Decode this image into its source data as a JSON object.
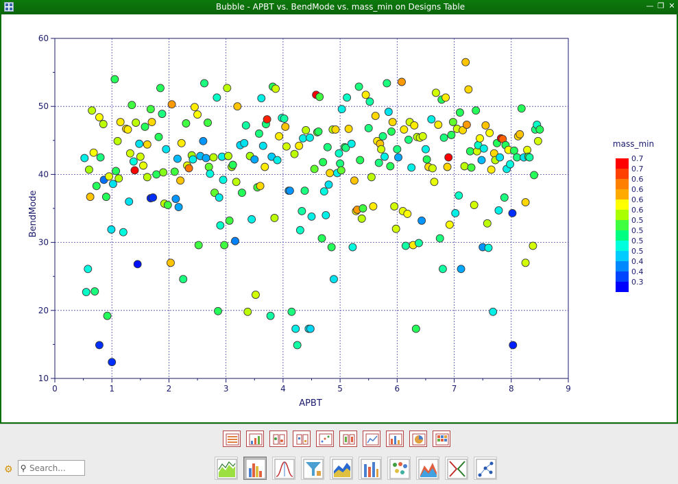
{
  "window": {
    "title": "Bubble - APBT vs. BendMode vs. mass_min on Designs Table",
    "controls": [
      "minimize",
      "restore",
      "close"
    ]
  },
  "search": {
    "placeholder": "Search..."
  },
  "toolbar": {
    "row1_icons": [
      "table-icon",
      "summary-table-icon",
      "filter-table-icon",
      "compare-table-icon",
      "scatter-table-icon",
      "filter-columns-icon",
      "line-chart-table-icon",
      "bar-chart-table-icon",
      "pie-table-icon",
      "correlation-table-icon"
    ],
    "row2_icons": [
      "line-chart-icon",
      "bubble-chart-icon",
      "histogram-icon",
      "funnel-filter-icon",
      "area-chart-icon",
      "bar-chart-icon",
      "bubble-grid-icon",
      "surface-chart-icon",
      "trade-off-icon",
      "network-plot-icon"
    ],
    "active_index": 1
  },
  "colors": {
    "title_bar": "#0a6e0a",
    "axis": "#1a1a6e",
    "grid": "#4a4ab0"
  },
  "chart_data": {
    "type": "scatter",
    "title": "",
    "xlabel": "APBT",
    "ylabel": "BendMode",
    "xlim": [
      0,
      9
    ],
    "ylim": [
      10,
      60
    ],
    "x_ticks": [
      0,
      1,
      2,
      3,
      4,
      5,
      6,
      7,
      8,
      9
    ],
    "y_ticks": [
      10,
      20,
      30,
      40,
      50,
      60
    ],
    "grid": true,
    "color_by": "mass_min",
    "legend": {
      "title": "mass_min",
      "placement": "right",
      "labels": [
        "0.7",
        "0.7",
        "0.6",
        "0.6",
        "0.6",
        "0.6",
        "0.5",
        "0.5",
        "0.5",
        "0.5",
        "0.4",
        "0.4",
        "0.3"
      ],
      "colors": [
        "#ff0000",
        "#ff4000",
        "#ff8000",
        "#ffaa00",
        "#ffff00",
        "#aaff00",
        "#40ff40",
        "#00ff80",
        "#00ffdd",
        "#00ccff",
        "#0088ff",
        "#0044ff",
        "#0000ff"
      ]
    },
    "points": [
      [
        0.52,
        42.4,
        0.48
      ],
      [
        0.55,
        22.7,
        0.5
      ],
      [
        0.58,
        26.1,
        0.49
      ],
      [
        0.6,
        40.7,
        0.57
      ],
      [
        0.62,
        36.7,
        0.64
      ],
      [
        0.65,
        49.4,
        0.58
      ],
      [
        0.68,
        43.2,
        0.61
      ],
      [
        0.7,
        22.8,
        0.52
      ],
      [
        0.73,
        38.3,
        0.53
      ],
      [
        0.78,
        48.4,
        0.61
      ],
      [
        0.8,
        42.5,
        0.52
      ],
      [
        0.78,
        14.9,
        0.36
      ],
      [
        0.85,
        47.4,
        0.58
      ],
      [
        0.86,
        39.2,
        0.4
      ],
      [
        0.9,
        36.7,
        0.53
      ],
      [
        0.92,
        19.2,
        0.53
      ],
      [
        0.95,
        39.7,
        0.6
      ],
      [
        0.99,
        31.9,
        0.47
      ],
      [
        1.02,
        38.6,
        0.47
      ],
      [
        1.05,
        54.0,
        0.53
      ],
      [
        1.07,
        40.5,
        0.53
      ],
      [
        1.0,
        12.4,
        0.36
      ],
      [
        1.1,
        44.9,
        0.58
      ],
      [
        1.12,
        39.4,
        0.58
      ],
      [
        1.15,
        47.7,
        0.62
      ],
      [
        1.2,
        31.5,
        0.49
      ],
      [
        1.25,
        46.7,
        0.63
      ],
      [
        1.3,
        36.0,
        0.47
      ],
      [
        1.28,
        46.6,
        0.62
      ],
      [
        1.32,
        43.1,
        0.59
      ],
      [
        1.35,
        50.2,
        0.54
      ],
      [
        1.38,
        41.9,
        0.49
      ],
      [
        1.4,
        40.6,
        0.72
      ],
      [
        1.42,
        47.6,
        0.58
      ],
      [
        1.45,
        26.8,
        0.34
      ],
      [
        1.48,
        44.5,
        0.47
      ],
      [
        1.5,
        42.6,
        0.59
      ],
      [
        1.55,
        41.3,
        0.6
      ],
      [
        1.58,
        47.0,
        0.53
      ],
      [
        1.62,
        44.4,
        0.63
      ],
      [
        1.62,
        39.6,
        0.58
      ],
      [
        1.68,
        49.6,
        0.54
      ],
      [
        1.7,
        47.7,
        0.63
      ],
      [
        1.68,
        36.5,
        0.35
      ],
      [
        1.72,
        36.6,
        0.36
      ],
      [
        1.78,
        40.0,
        0.53
      ],
      [
        1.82,
        45.5,
        0.53
      ],
      [
        1.85,
        52.7,
        0.53
      ],
      [
        1.88,
        48.9,
        0.52
      ],
      [
        1.9,
        40.3,
        0.56
      ],
      [
        1.92,
        35.7,
        0.58
      ],
      [
        1.95,
        43.7,
        0.47
      ],
      [
        1.98,
        35.5,
        0.54
      ],
      [
        2.03,
        27.0,
        0.64
      ],
      [
        2.05,
        50.3,
        0.66
      ],
      [
        2.1,
        40.4,
        0.54
      ],
      [
        2.12,
        36.4,
        0.42
      ],
      [
        2.15,
        42.3,
        0.44
      ],
      [
        2.17,
        35.2,
        0.43
      ],
      [
        2.2,
        39.1,
        0.64
      ],
      [
        2.22,
        44.6,
        0.62
      ],
      [
        2.25,
        24.6,
        0.52
      ],
      [
        2.3,
        47.5,
        0.54
      ],
      [
        2.32,
        41.3,
        0.6
      ],
      [
        2.35,
        40.9,
        0.68
      ],
      [
        2.4,
        42.8,
        0.57
      ],
      [
        2.42,
        42.2,
        0.48
      ],
      [
        2.45,
        49.9,
        0.62
      ],
      [
        2.5,
        48.8,
        0.61
      ],
      [
        2.55,
        42.7,
        0.44
      ],
      [
        2.52,
        29.6,
        0.54
      ],
      [
        2.6,
        44.9,
        0.42
      ],
      [
        2.62,
        53.4,
        0.52
      ],
      [
        2.65,
        42.4,
        0.43
      ],
      [
        2.68,
        47.6,
        0.54
      ],
      [
        2.7,
        41.1,
        0.55
      ],
      [
        2.72,
        40.1,
        0.49
      ],
      [
        2.78,
        42.5,
        0.58
      ],
      [
        2.8,
        37.3,
        0.55
      ],
      [
        2.84,
        51.3,
        0.5
      ],
      [
        2.86,
        19.9,
        0.53
      ],
      [
        2.88,
        36.6,
        0.48
      ],
      [
        2.9,
        32.5,
        0.5
      ],
      [
        2.93,
        42.6,
        0.48
      ],
      [
        2.95,
        39.2,
        0.49
      ],
      [
        2.97,
        29.6,
        0.54
      ],
      [
        3.02,
        52.7,
        0.58
      ],
      [
        3.04,
        42.7,
        0.58
      ],
      [
        3.06,
        33.2,
        0.54
      ],
      [
        3.1,
        41.1,
        0.57
      ],
      [
        3.12,
        41.4,
        0.53
      ],
      [
        3.16,
        30.2,
        0.41
      ],
      [
        3.18,
        38.9,
        0.58
      ],
      [
        3.2,
        50.0,
        0.64
      ],
      [
        3.25,
        44.3,
        0.46
      ],
      [
        3.28,
        37.3,
        0.53
      ],
      [
        3.32,
        44.6,
        0.47
      ],
      [
        3.35,
        47.2,
        0.51
      ],
      [
        3.38,
        19.8,
        0.58
      ],
      [
        3.42,
        42.7,
        0.57
      ],
      [
        3.45,
        33.4,
        0.48
      ],
      [
        3.5,
        42.2,
        0.43
      ],
      [
        3.52,
        22.3,
        0.59
      ],
      [
        3.55,
        38.1,
        0.54
      ],
      [
        3.58,
        46.0,
        0.52
      ],
      [
        3.6,
        38.3,
        0.63
      ],
      [
        3.62,
        51.2,
        0.48
      ],
      [
        3.65,
        44.2,
        0.47
      ],
      [
        3.68,
        41.1,
        0.62
      ],
      [
        3.7,
        47.4,
        0.52
      ],
      [
        3.72,
        48.1,
        0.71
      ],
      [
        3.78,
        19.2,
        0.51
      ],
      [
        3.8,
        42.6,
        0.45
      ],
      [
        3.82,
        52.9,
        0.53
      ],
      [
        3.85,
        33.6,
        0.58
      ],
      [
        3.87,
        52.6,
        0.59
      ],
      [
        3.9,
        42.1,
        0.48
      ],
      [
        3.93,
        45.6,
        0.62
      ],
      [
        3.98,
        48.3,
        0.5
      ],
      [
        4.02,
        48.2,
        0.51
      ],
      [
        4.04,
        47.0,
        0.64
      ],
      [
        4.06,
        44.1,
        0.59
      ],
      [
        4.1,
        37.6,
        0.43
      ],
      [
        4.12,
        37.6,
        0.42
      ],
      [
        4.15,
        19.8,
        0.52
      ],
      [
        4.2,
        43.0,
        0.58
      ],
      [
        4.22,
        17.3,
        0.48
      ],
      [
        4.25,
        14.9,
        0.51
      ],
      [
        4.28,
        44.2,
        0.62
      ],
      [
        4.3,
        31.8,
        0.5
      ],
      [
        4.33,
        34.6,
        0.51
      ],
      [
        4.35,
        45.3,
        0.48
      ],
      [
        4.38,
        37.6,
        0.52
      ],
      [
        4.4,
        46.5,
        0.58
      ],
      [
        4.45,
        17.3,
        0.47
      ],
      [
        4.48,
        17.3,
        0.46
      ],
      [
        4.47,
        45.4,
        0.48
      ],
      [
        4.5,
        33.8,
        0.48
      ],
      [
        4.55,
        40.8,
        0.55
      ],
      [
        4.58,
        51.7,
        0.72
      ],
      [
        4.6,
        46.2,
        0.55
      ],
      [
        4.62,
        46.3,
        0.53
      ],
      [
        4.64,
        51.4,
        0.54
      ],
      [
        4.68,
        30.6,
        0.53
      ],
      [
        4.7,
        41.8,
        0.53
      ],
      [
        4.72,
        37.5,
        0.49
      ],
      [
        4.75,
        34.0,
        0.48
      ],
      [
        4.78,
        44.0,
        0.52
      ],
      [
        4.8,
        38.5,
        0.47
      ],
      [
        4.82,
        40.2,
        0.63
      ],
      [
        4.85,
        29.3,
        0.53
      ],
      [
        4.87,
        46.6,
        0.58
      ],
      [
        4.89,
        24.6,
        0.47
      ],
      [
        4.92,
        46.6,
        0.63
      ],
      [
        4.95,
        40.2,
        0.48
      ],
      [
        4.98,
        43.1,
        0.5
      ],
      [
        5.0,
        41.6,
        0.52
      ],
      [
        5.02,
        40.6,
        0.55
      ],
      [
        5.03,
        49.6,
        0.48
      ],
      [
        5.08,
        44.0,
        0.53
      ],
      [
        5.1,
        43.9,
        0.52
      ],
      [
        5.12,
        51.3,
        0.5
      ],
      [
        5.15,
        46.7,
        0.63
      ],
      [
        5.2,
        44.5,
        0.48
      ],
      [
        5.22,
        29.3,
        0.49
      ],
      [
        5.25,
        39.1,
        0.64
      ],
      [
        5.28,
        34.6,
        0.61
      ],
      [
        5.3,
        34.8,
        0.66
      ],
      [
        5.33,
        52.9,
        0.52
      ],
      [
        5.35,
        42.1,
        0.53
      ],
      [
        5.38,
        33.5,
        0.58
      ],
      [
        5.4,
        35.0,
        0.54
      ],
      [
        5.45,
        51.7,
        0.62
      ],
      [
        5.5,
        46.8,
        0.52
      ],
      [
        5.52,
        50.7,
        0.51
      ],
      [
        5.55,
        39.6,
        0.58
      ],
      [
        5.58,
        35.3,
        0.62
      ],
      [
        5.62,
        48.6,
        0.63
      ],
      [
        5.65,
        44.9,
        0.62
      ],
      [
        5.68,
        41.7,
        0.52
      ],
      [
        5.7,
        44.5,
        0.64
      ],
      [
        5.72,
        43.7,
        0.59
      ],
      [
        5.75,
        45.6,
        0.52
      ],
      [
        5.78,
        42.6,
        0.48
      ],
      [
        5.82,
        53.4,
        0.52
      ],
      [
        5.85,
        49.2,
        0.47
      ],
      [
        5.88,
        41.2,
        0.53
      ],
      [
        5.9,
        46.3,
        0.53
      ],
      [
        5.92,
        47.7,
        0.63
      ],
      [
        5.95,
        35.3,
        0.59
      ],
      [
        5.98,
        32.0,
        0.59
      ],
      [
        6.0,
        43.7,
        0.52
      ],
      [
        6.02,
        42.5,
        0.43
      ],
      [
        6.08,
        53.6,
        0.66
      ],
      [
        6.1,
        34.6,
        0.6
      ],
      [
        6.12,
        46.6,
        0.62
      ],
      [
        6.15,
        29.5,
        0.51
      ],
      [
        6.18,
        34.2,
        0.61
      ],
      [
        6.2,
        45.1,
        0.52
      ],
      [
        6.22,
        47.7,
        0.59
      ],
      [
        6.25,
        41.0,
        0.48
      ],
      [
        6.28,
        29.6,
        0.62
      ],
      [
        6.3,
        47.2,
        0.62
      ],
      [
        6.35,
        45.5,
        0.58
      ],
      [
        6.33,
        17.3,
        0.53
      ],
      [
        6.38,
        29.9,
        0.51
      ],
      [
        6.4,
        45.4,
        0.59
      ],
      [
        6.43,
        33.2,
        0.42
      ],
      [
        6.45,
        45.6,
        0.59
      ],
      [
        6.5,
        43.7,
        0.48
      ],
      [
        6.52,
        42.2,
        0.53
      ],
      [
        6.55,
        41.1,
        0.63
      ],
      [
        6.6,
        48.1,
        0.48
      ],
      [
        6.62,
        40.9,
        0.59
      ],
      [
        6.65,
        38.9,
        0.6
      ],
      [
        6.68,
        52.0,
        0.59
      ],
      [
        6.72,
        47.3,
        0.62
      ],
      [
        6.75,
        30.6,
        0.52
      ],
      [
        6.78,
        51.0,
        0.53
      ],
      [
        6.8,
        26.1,
        0.51
      ],
      [
        6.82,
        45.4,
        0.52
      ],
      [
        6.85,
        51.3,
        0.62
      ],
      [
        6.88,
        41.1,
        0.63
      ],
      [
        6.9,
        42.5,
        0.72
      ],
      [
        6.92,
        32.6,
        0.61
      ],
      [
        6.95,
        45.8,
        0.53
      ],
      [
        6.98,
        47.7,
        0.55
      ],
      [
        7.02,
        34.3,
        0.48
      ],
      [
        7.05,
        46.7,
        0.59
      ],
      [
        7.08,
        36.9,
        0.5
      ],
      [
        7.1,
        49.1,
        0.53
      ],
      [
        7.12,
        26.1,
        0.43
      ],
      [
        7.15,
        46.5,
        0.63
      ],
      [
        7.18,
        41.2,
        0.58
      ],
      [
        7.2,
        56.5,
        0.64
      ],
      [
        7.22,
        47.3,
        0.66
      ],
      [
        7.25,
        52.5,
        0.63
      ],
      [
        7.28,
        43.4,
        0.53
      ],
      [
        7.3,
        41.0,
        0.54
      ],
      [
        7.35,
        35.5,
        0.59
      ],
      [
        7.38,
        49.4,
        0.53
      ],
      [
        7.4,
        43.4,
        0.59
      ],
      [
        7.42,
        44.3,
        0.5
      ],
      [
        7.45,
        45.3,
        0.61
      ],
      [
        7.48,
        42.1,
        0.44
      ],
      [
        7.5,
        29.3,
        0.42
      ],
      [
        7.52,
        43.8,
        0.48
      ],
      [
        7.55,
        47.2,
        0.64
      ],
      [
        7.58,
        32.8,
        0.58
      ],
      [
        7.6,
        29.2,
        0.49
      ],
      [
        7.62,
        46.1,
        0.61
      ],
      [
        7.65,
        40.7,
        0.62
      ],
      [
        7.68,
        19.8,
        0.48
      ],
      [
        7.7,
        43.1,
        0.63
      ],
      [
        7.72,
        42.1,
        0.58
      ],
      [
        7.75,
        44.6,
        0.53
      ],
      [
        7.78,
        34.7,
        0.48
      ],
      [
        7.8,
        42.5,
        0.47
      ],
      [
        7.82,
        45.3,
        0.72
      ],
      [
        7.85,
        45.2,
        0.69
      ],
      [
        7.88,
        36.6,
        0.52
      ],
      [
        7.9,
        44.3,
        0.53
      ],
      [
        7.92,
        40.8,
        0.48
      ],
      [
        7.95,
        43.6,
        0.61
      ],
      [
        7.98,
        41.5,
        0.49
      ],
      [
        8.02,
        34.3,
        0.36
      ],
      [
        8.03,
        14.9,
        0.35
      ],
      [
        8.05,
        43.5,
        0.53
      ],
      [
        8.1,
        42.5,
        0.52
      ],
      [
        8.12,
        45.6,
        0.63
      ],
      [
        8.15,
        45.9,
        0.64
      ],
      [
        8.18,
        49.7,
        0.53
      ],
      [
        8.22,
        42.5,
        0.47
      ],
      [
        8.25,
        27.0,
        0.59
      ],
      [
        8.25,
        35.9,
        0.63
      ],
      [
        8.28,
        43.6,
        0.6
      ],
      [
        8.3,
        42.6,
        0.54
      ],
      [
        8.32,
        42.5,
        0.51
      ],
      [
        8.38,
        29.5,
        0.59
      ],
      [
        8.4,
        39.9,
        0.53
      ],
      [
        8.42,
        46.6,
        0.52
      ],
      [
        8.45,
        47.3,
        0.5
      ],
      [
        8.47,
        44.9,
        0.59
      ],
      [
        8.5,
        46.6,
        0.53
      ]
    ]
  }
}
